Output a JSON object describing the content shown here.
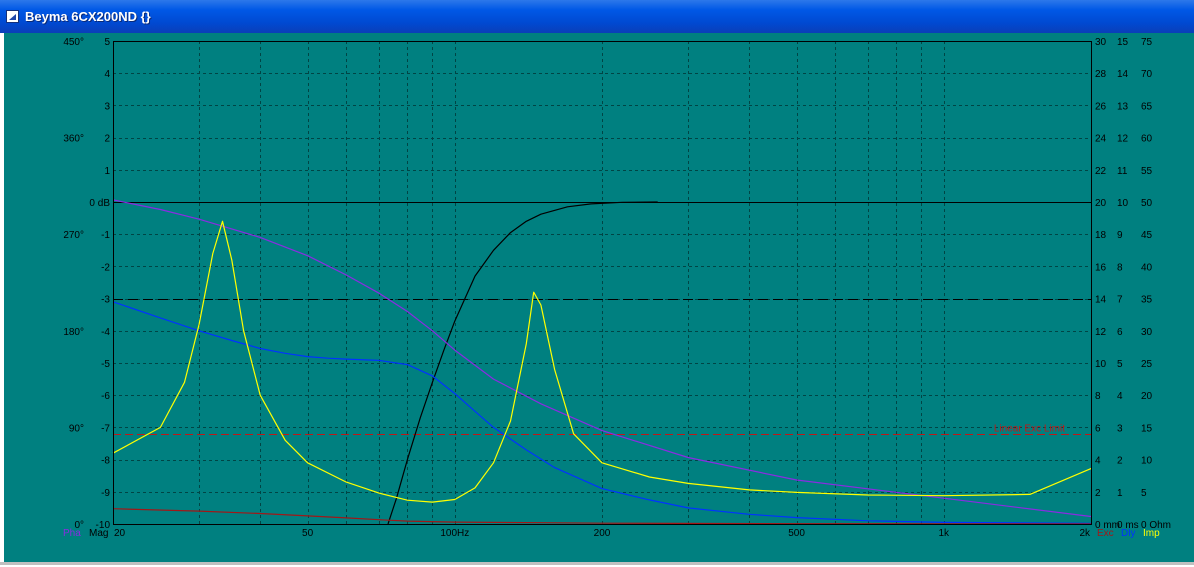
{
  "window": {
    "title": "Beyma 6CX200ND {}"
  },
  "colors": {
    "background": "#008080",
    "grid": "#004545",
    "magnitude": "#000000",
    "phase": "#8a2be2",
    "delay": "#0033ff",
    "impedance": "#ffff00",
    "excursion": "#a01818",
    "limit": "#c01818"
  },
  "chart_data": {
    "type": "line",
    "x_scale": "log",
    "xlim": [
      20,
      2000
    ],
    "x_ticks": [
      {
        "value": 20,
        "label": "20"
      },
      {
        "value": 50,
        "label": "50"
      },
      {
        "value": 100,
        "label": "100Hz"
      },
      {
        "value": 200,
        "label": "200"
      },
      {
        "value": 500,
        "label": "500"
      },
      {
        "value": 1000,
        "label": "1k"
      },
      {
        "value": 2000,
        "label": "2k"
      }
    ],
    "x_minor": [
      30,
      40,
      60,
      70,
      80,
      90,
      300,
      400,
      600,
      700,
      800,
      900
    ],
    "mag_axis": {
      "ylim": [
        -10,
        5
      ],
      "ticks": [
        {
          "value": 5,
          "label": "5"
        },
        {
          "value": 4,
          "label": "4"
        },
        {
          "value": 3,
          "label": "3"
        },
        {
          "value": 2,
          "label": "2"
        },
        {
          "value": 1,
          "label": "1"
        },
        {
          "value": 0,
          "label": "0 dB"
        },
        {
          "value": -1,
          "label": "-1"
        },
        {
          "value": -2,
          "label": "-2"
        },
        {
          "value": -3,
          "label": "-3"
        },
        {
          "value": -4,
          "label": "-4"
        },
        {
          "value": -5,
          "label": "-5"
        },
        {
          "value": -6,
          "label": "-6"
        },
        {
          "value": -7,
          "label": "-7"
        },
        {
          "value": -8,
          "label": "-8"
        },
        {
          "value": -9,
          "label": "-9"
        },
        {
          "value": -10,
          "label": "-10"
        }
      ],
      "name": "Mag"
    },
    "phase_axis": {
      "ylim": [
        0,
        450
      ],
      "ticks": [
        {
          "value": 450,
          "label": "450°"
        },
        {
          "value": 360,
          "label": "360°"
        },
        {
          "value": 270,
          "label": "270°"
        },
        {
          "value": 180,
          "label": "180°"
        },
        {
          "value": 90,
          "label": "90°"
        },
        {
          "value": 0,
          "label": "0°"
        }
      ],
      "name": "Pha"
    },
    "exc_axis": {
      "ylim": [
        0,
        30
      ],
      "ticks": [
        "30",
        "28",
        "26",
        "24",
        "22",
        "20",
        "18",
        "16",
        "14",
        "12",
        "10",
        "8",
        "6",
        "4",
        "2",
        "0 mm"
      ],
      "name": "Exc"
    },
    "dly_axis": {
      "ylim": [
        0,
        15
      ],
      "ticks": [
        "15",
        "14",
        "13",
        "12",
        "11",
        "10",
        "9",
        "8",
        "7",
        "6",
        "5",
        "4",
        "3",
        "2",
        "1",
        "0 ms"
      ],
      "name": "Dly"
    },
    "imp_axis": {
      "ylim": [
        0,
        75
      ],
      "ticks": [
        "75",
        "70",
        "65",
        "60",
        "55",
        "50",
        "45",
        "40",
        "35",
        "30",
        "25",
        "20",
        "15",
        "10",
        "5",
        "0 Ohm"
      ],
      "name": "Imp"
    },
    "reference_lines": [
      {
        "axis": "mag",
        "value": 0,
        "style": "solid"
      },
      {
        "axis": "mag",
        "value": -3,
        "style": "dashed"
      },
      {
        "axis": "exc",
        "value": 5.6,
        "style": "dashed",
        "label": "Linear Exc Limit"
      }
    ],
    "series": [
      {
        "key": "mag",
        "axis": "mag",
        "color": "#000000",
        "x": [
          73,
          76,
          80,
          85,
          90,
          95,
          100,
          110,
          120,
          130,
          140,
          150,
          170,
          190,
          220,
          260
        ],
        "y": [
          -10,
          -9.2,
          -8.0,
          -6.7,
          -5.6,
          -4.6,
          -3.7,
          -2.3,
          -1.5,
          -0.95,
          -0.6,
          -0.38,
          -0.15,
          -0.06,
          -0.01,
          0
        ]
      },
      {
        "key": "pha",
        "axis": "phase",
        "color": "#8a2be2",
        "x": [
          20,
          25,
          30,
          40,
          50,
          60,
          70,
          80,
          90,
          100,
          120,
          150,
          200,
          300,
          500,
          1000,
          2000
        ],
        "y": [
          302,
          293,
          284,
          267,
          250,
          232,
          215,
          198,
          180,
          162,
          135,
          112,
          87,
          62,
          41,
          24,
          7
        ]
      },
      {
        "key": "dly",
        "axis": "dly",
        "color": "#0033ff",
        "x": [
          20,
          25,
          30,
          35,
          40,
          45,
          50,
          55,
          60,
          70,
          80,
          90,
          100,
          110,
          120,
          140,
          160,
          200,
          250,
          300,
          400,
          500,
          700,
          1000,
          2000
        ],
        "y": [
          6.9,
          6.4,
          6.0,
          5.7,
          5.45,
          5.3,
          5.2,
          5.15,
          5.12,
          5.08,
          4.95,
          4.6,
          4.05,
          3.5,
          3.0,
          2.3,
          1.75,
          1.1,
          0.75,
          0.5,
          0.3,
          0.2,
          0.1,
          0.05,
          0.02
        ]
      },
      {
        "key": "imp",
        "axis": "imp",
        "color": "#ffff00",
        "x": [
          20,
          25,
          28,
          30,
          32,
          33.5,
          35,
          37,
          40,
          45,
          50,
          60,
          70,
          80,
          90,
          100,
          110,
          120,
          130,
          140,
          145,
          150,
          160,
          175,
          200,
          250,
          300,
          400,
          500,
          700,
          1000,
          1500,
          2000
        ],
        "y": [
          11,
          15,
          22,
          31,
          42,
          47,
          41,
          30,
          20,
          13,
          9.5,
          6.5,
          4.8,
          3.7,
          3.4,
          3.8,
          5.6,
          9.5,
          16,
          28,
          36,
          34,
          24,
          14,
          9.5,
          7.3,
          6.3,
          5.3,
          4.9,
          4.5,
          4.4,
          4.6,
          8.6
        ]
      },
      {
        "key": "exc",
        "axis": "exc",
        "color": "#a01818",
        "x": [
          20,
          30,
          40,
          50,
          60,
          70,
          80,
          100,
          150,
          200,
          500,
          1000,
          2000
        ],
        "y": [
          0.95,
          0.8,
          0.65,
          0.5,
          0.38,
          0.27,
          0.18,
          0.12,
          0.08,
          0.05,
          0.02,
          0.01,
          0.0
        ]
      }
    ]
  }
}
